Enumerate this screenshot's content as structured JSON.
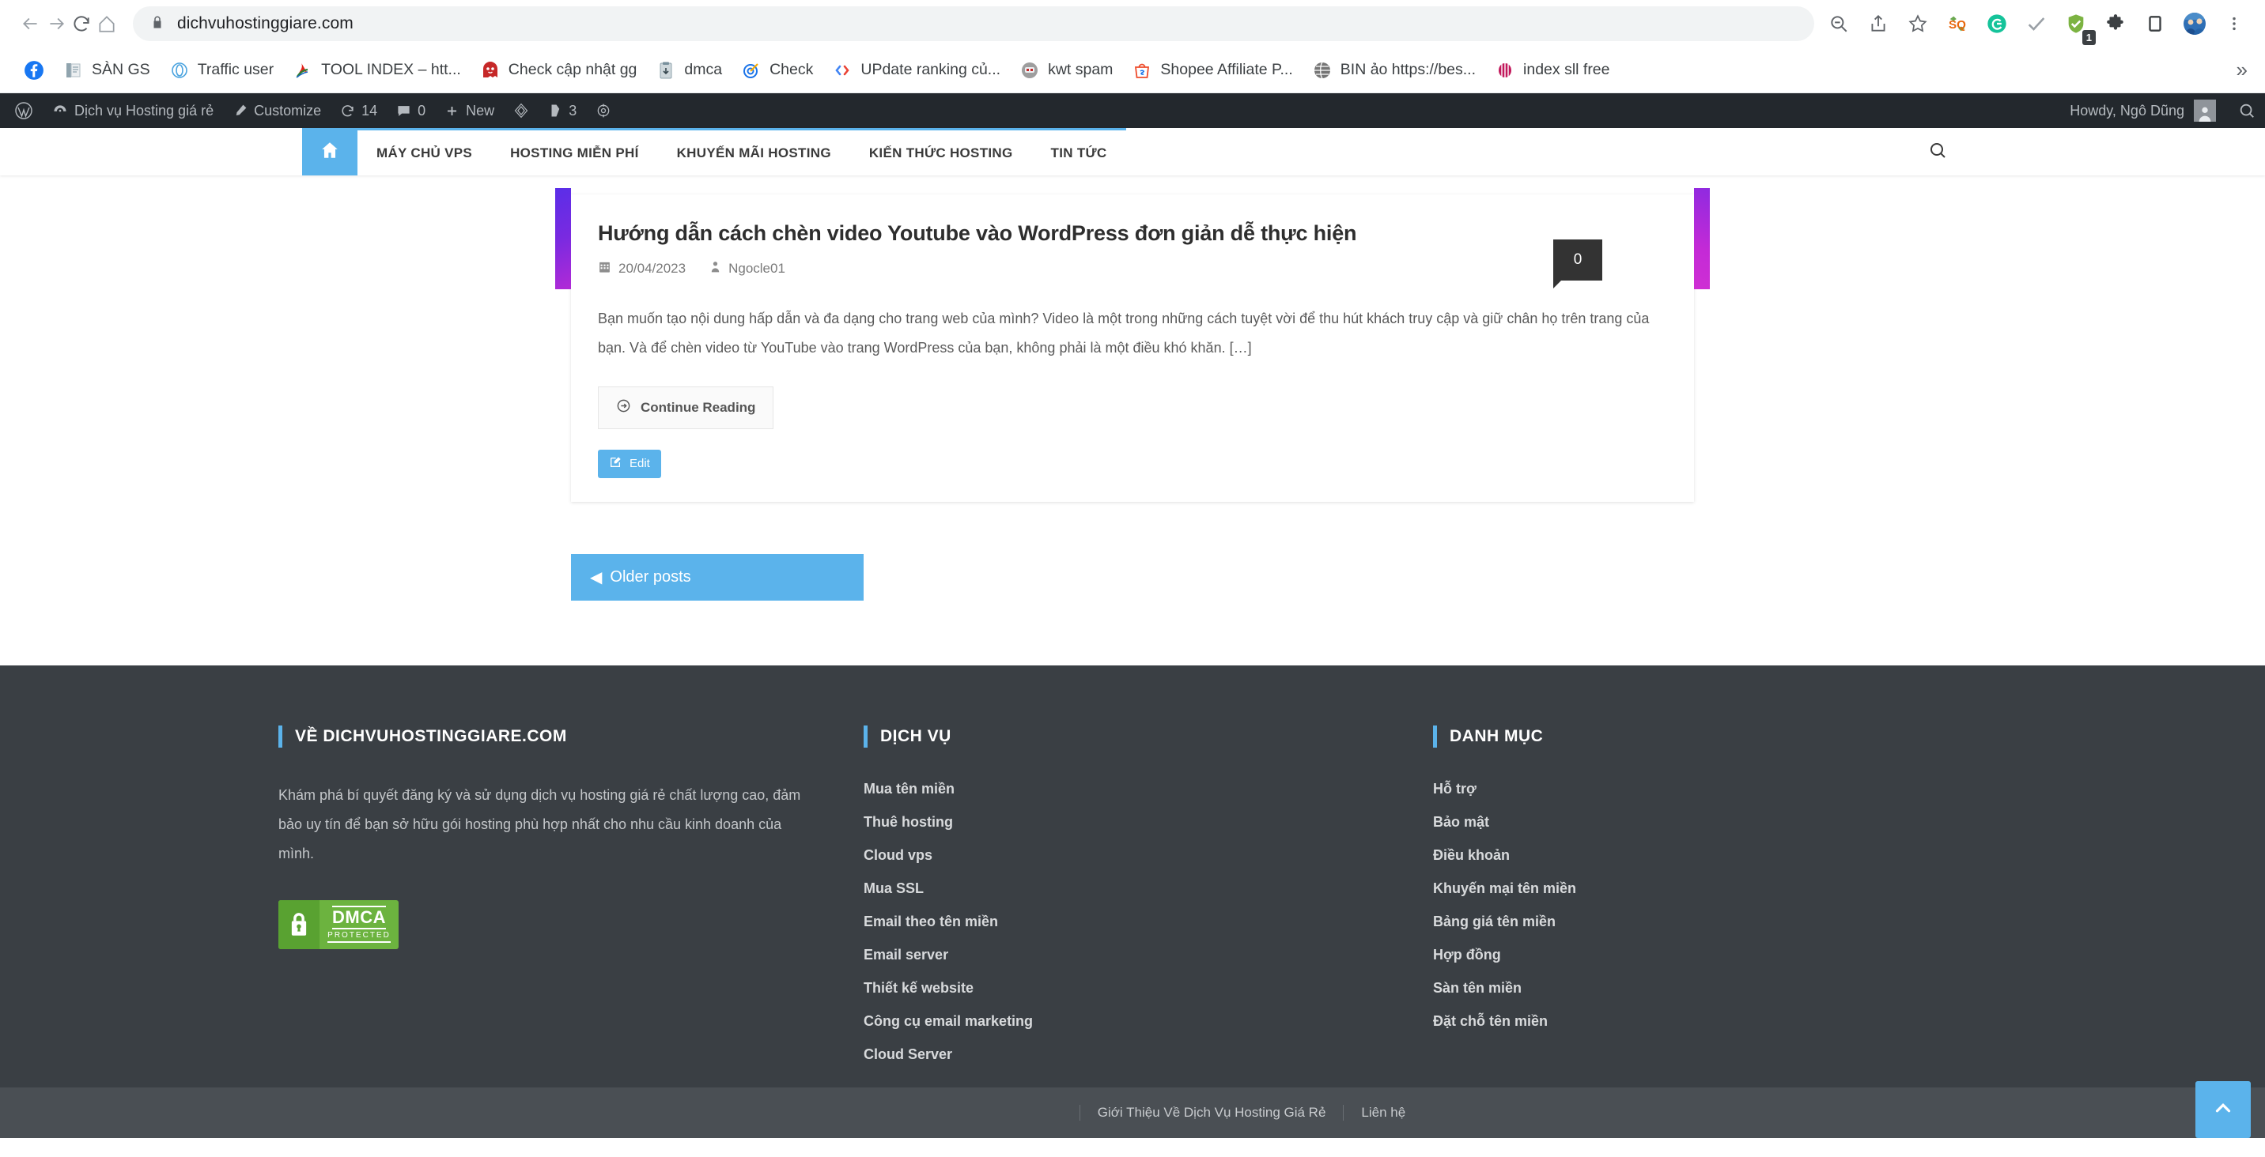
{
  "browser": {
    "url": "dichvuhostinggiare.com",
    "nav": {
      "back": "back-arrow",
      "forward": "forward-arrow",
      "reload": "reload",
      "home": "home"
    },
    "lock_icon": "lock-icon",
    "right_icons": [
      {
        "name": "zoom-out-icon",
        "glyph": "search-minus"
      },
      {
        "name": "share-icon",
        "glyph": "share"
      },
      {
        "name": "bookmark-star-icon",
        "glyph": "star"
      },
      {
        "name": "seoquake-extension-icon",
        "glyph": "SQ"
      },
      {
        "name": "grammarly-extension-icon",
        "glyph": "G"
      },
      {
        "name": "checkmark-extension-icon",
        "glyph": "check"
      },
      {
        "name": "adblock-extension-icon",
        "glyph": "shield",
        "badge": "1"
      },
      {
        "name": "extensions-puzzle-icon",
        "glyph": "puzzle"
      },
      {
        "name": "sidepanel-icon",
        "glyph": "panel"
      },
      {
        "name": "profile-avatar-icon",
        "glyph": "avatar"
      },
      {
        "name": "browser-menu-icon",
        "glyph": "kebab"
      }
    ]
  },
  "bookmarks": {
    "items": [
      {
        "label": "",
        "icon": "facebook-icon"
      },
      {
        "label": "SÀN GS",
        "icon": "documents-icon"
      },
      {
        "label": "Traffic user",
        "icon": "circle-icon"
      },
      {
        "label": "TOOL INDEX – htt...",
        "icon": "acrobat-icon"
      },
      {
        "label": "Check cập nhật gg",
        "icon": "ghost-icon"
      },
      {
        "label": "dmca",
        "icon": "clipboard-icon"
      },
      {
        "label": "Check",
        "icon": "target-icon"
      },
      {
        "label": "UPdate ranking củ...",
        "icon": "code-icon"
      },
      {
        "label": "kwt spam",
        "icon": "robot-icon"
      },
      {
        "label": "Shopee Affiliate P...",
        "icon": "shopee-icon"
      },
      {
        "label": "BIN ảo https://bes...",
        "icon": "globe-icon"
      },
      {
        "label": "index sll free",
        "icon": "crown-icon"
      }
    ],
    "overflow": "»"
  },
  "wp_adminbar": {
    "logo": "wordpress-logo-icon",
    "site_name": "Dịch vụ Hosting giá rẻ",
    "customize": "Customize",
    "updates_count": "14",
    "comments_count": "0",
    "new": "New",
    "elementor": "elementor-icon",
    "yoast_count": "3",
    "autoptimize": "autoptimize-icon",
    "howdy": "Howdy, Ngô Dũng",
    "search": "search-icon"
  },
  "site_nav": {
    "home_icon": "home-icon",
    "items": [
      "MÁY CHỦ VPS",
      "HOSTING MIỄN PHÍ",
      "KHUYẾN MÃI HOSTING",
      "KIẾN THỨC HOSTING",
      "TIN TỨC"
    ],
    "search_icon": "search-icon"
  },
  "post": {
    "title": "Hướng dẫn cách chèn video Youtube vào WordPress đơn giản dễ thực hiện",
    "date": "20/04/2023",
    "author": "Ngocle01",
    "comment_count": "0",
    "excerpt": "Bạn muốn tạo nội dung hấp dẫn và đa dạng cho trang web của mình? Video là một trong những cách tuyệt vời để thu hút khách truy cập và giữ chân họ trên trang của bạn. Và để chèn video từ YouTube vào trang WordPress của bạn, không phải là một điều khó khăn. […]",
    "continue_label": "Continue Reading",
    "edit_label": "Edit"
  },
  "pagination": {
    "older_label": "Older posts"
  },
  "footer": {
    "columns": [
      {
        "title": "VỀ DICHVUHOSTINGGIARE.COM",
        "about": "Khám phá bí quyết đăng ký và sử dụng dịch vụ hosting giá rẻ chất lượng cao, đảm bảo uy tín để bạn sở hữu gói hosting phù hợp nhất cho nhu cầu kinh doanh của mình.",
        "badge": {
          "main": "DMCA",
          "sub": "PROTECTED"
        },
        "links": []
      },
      {
        "title": "DỊCH VỤ",
        "links": [
          "Mua tên miền",
          "Thuê hosting",
          "Cloud vps",
          "Mua SSL",
          "Email theo tên miền",
          "Email server",
          "Thiết kế website",
          "Công cụ email marketing",
          "Cloud Server"
        ]
      },
      {
        "title": "DANH MỤC",
        "links": [
          "Hỗ trợ",
          "Bảo mật",
          "Điều khoản",
          "Khuyến mại tên miền",
          "Bảng giá tên miền",
          "Hợp đồng",
          "Sàn tên miền",
          "Đặt chỗ tên miền"
        ]
      }
    ],
    "bottom_links": [
      "Giới Thiệu Về Dịch Vụ Hosting Giá Rẻ",
      "Liên hệ"
    ],
    "scroll_top_icon": "chevron-up-icon"
  },
  "colors": {
    "accent": "#5bb3eb",
    "footer_bg": "#3a3f44",
    "footer_bottom_bg": "#4a4f54",
    "adminbar_bg": "#23282d",
    "dmca_green": "#6cb33f"
  }
}
